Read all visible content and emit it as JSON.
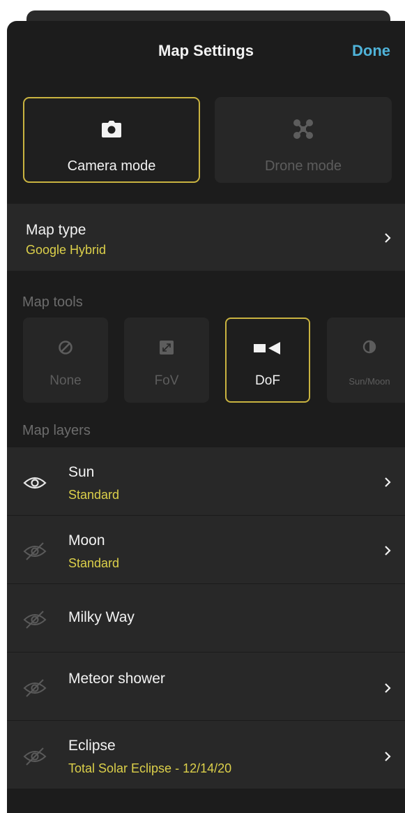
{
  "header": {
    "title": "Map Settings",
    "done_label": "Done"
  },
  "modes": [
    {
      "label": "Camera mode",
      "icon": "camera-icon",
      "selected": true
    },
    {
      "label": "Drone mode",
      "icon": "drone-icon",
      "selected": false
    }
  ],
  "map_type": {
    "label": "Map type",
    "value": "Google Hybrid"
  },
  "map_tools": {
    "label": "Map tools",
    "items": [
      {
        "label": "None",
        "icon": "none-icon",
        "selected": false
      },
      {
        "label": "FoV",
        "icon": "fov-icon",
        "selected": false
      },
      {
        "label": "DoF",
        "icon": "dof-icon",
        "selected": true
      },
      {
        "label": "Sun/Moon",
        "icon": "sun-moon-icon",
        "selected": false
      }
    ]
  },
  "map_layers": {
    "label": "Map layers",
    "items": [
      {
        "name": "Sun",
        "value": "Standard",
        "visible": true
      },
      {
        "name": "Moon",
        "value": "Standard",
        "visible": false
      },
      {
        "name": "Milky Way",
        "value": "",
        "visible": false
      },
      {
        "name": "Meteor shower",
        "value": "",
        "visible": false
      },
      {
        "name": "Eclipse",
        "value": "Total Solar Eclipse - 12/14/20",
        "visible": false
      }
    ]
  },
  "colors": {
    "accent": "#c9b340",
    "value_text": "#dcd04a",
    "done": "#4fb3d9",
    "background": "#1c1c1c"
  }
}
